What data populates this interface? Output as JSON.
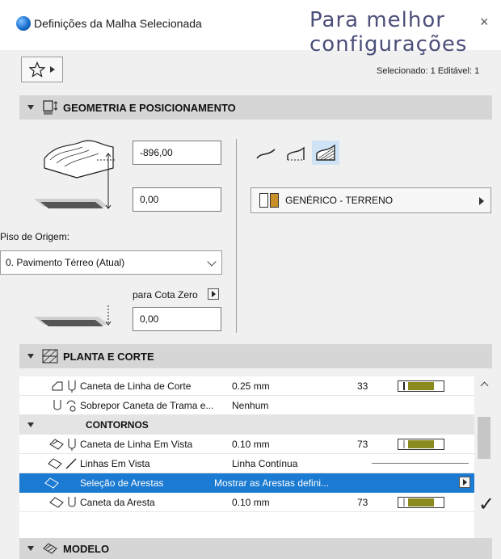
{
  "window": {
    "title": "Definições da Malha Selecionada",
    "overlay_text": "Para melhor configurações",
    "selected_info": "Selecionado: 1 Editável: 1"
  },
  "geometry": {
    "header": "GEOMETRIA E POSICIONAMENTO",
    "height_value": "-896,00",
    "offset_value": "0,00",
    "origin_floor_label": "Piso de Origem:",
    "origin_floor_value": "0. Pavimento Térreo (Atual)",
    "zero_ref_label": "para Cota Zero",
    "zero_ref_value": "0,00",
    "material_label": "GENÉRICO - TERRENO"
  },
  "plan_section": {
    "header": "PLANTA E CORTE",
    "rows": [
      {
        "name": "Caneta de Linha de Corte",
        "value": "0.25 mm",
        "num": "33"
      },
      {
        "name": "Sobrepor Caneta de Trama e...",
        "value": "Nenhum",
        "num": ""
      },
      {
        "group": "CONTORNOS"
      },
      {
        "name": "Caneta de Linha Em Vista",
        "value": "0.10 mm",
        "num": "73"
      },
      {
        "name": "Linhas Em Vista",
        "value": "Linha Contínua",
        "num": ""
      },
      {
        "name": "Seleção de Arestas",
        "value": "Mostrar as Arestas defini...",
        "num": ""
      },
      {
        "name": "Caneta da Aresta",
        "value": "0.10 mm",
        "num": "73"
      }
    ]
  },
  "model_section": {
    "header": "MODELO"
  },
  "colors": {
    "selection": "#1b7ad1",
    "pen_fill": "#8a8a1e",
    "accent_blue": "#1a6fd0"
  }
}
